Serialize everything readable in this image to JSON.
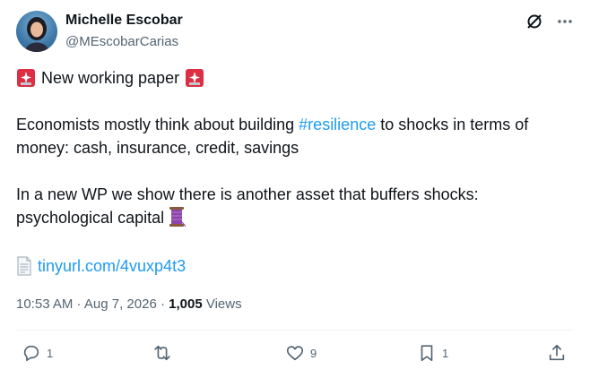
{
  "author": {
    "name": "Michelle Escobar",
    "handle": "@MEscobarCarias"
  },
  "post": {
    "line1": "New working paper",
    "para2_before": "Economists mostly think about building ",
    "hashtag": "#resilience",
    "para2_after": " to shocks in terms of money: cash, insurance, credit, savings",
    "para3": "In a new WP we show there is another asset that buffers shocks: psychological capital",
    "link": "tinyurl.com/4vuxp4t3"
  },
  "meta": {
    "time_date": "10:53 AM · Aug 7, 2026 · ",
    "views_count": "1,005",
    "views_label": " Views"
  },
  "actions": {
    "replies": "1",
    "reposts": "",
    "likes": "9",
    "bookmarks": "1"
  },
  "colors": {
    "link": "#1d9bf0",
    "muted": "#536471",
    "text": "#0f1419"
  }
}
